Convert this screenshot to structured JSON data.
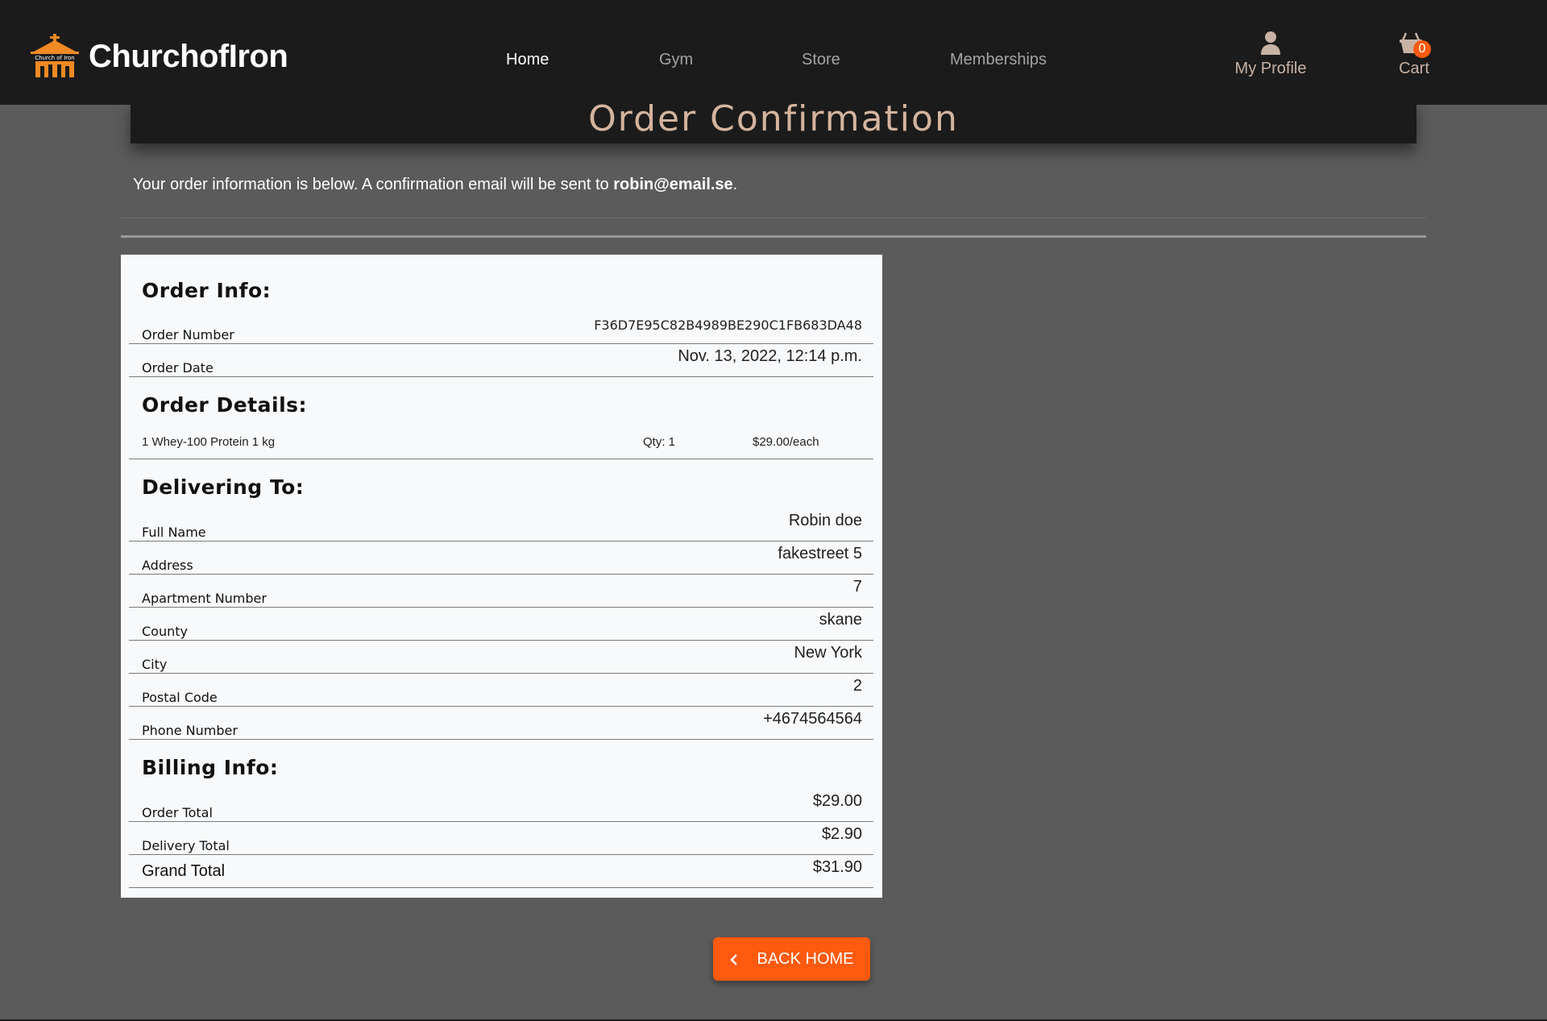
{
  "nav": {
    "brand": "ChurchofIron",
    "brand_mark_text": "Church of Iron",
    "links": [
      {
        "label": "Home",
        "active": true
      },
      {
        "label": "Gym",
        "active": false
      },
      {
        "label": "Store",
        "active": false
      },
      {
        "label": "Memberships",
        "active": false
      }
    ],
    "profile_label": "My Profile",
    "cart_label": "Cart",
    "cart_count": "0"
  },
  "page": {
    "title": "Order Confirmation",
    "intro_prefix": "Your order information is below. A confirmation email will be sent to ",
    "intro_email": "robin@email.se",
    "intro_suffix": "."
  },
  "order_info": {
    "heading": "Order Info:",
    "order_number_label": "Order Number",
    "order_number": "F36D7E95C82B4989BE290C1FB683DA48",
    "order_date_label": "Order Date",
    "order_date": "Nov. 13, 2022, 12:14 p.m."
  },
  "order_details": {
    "heading": "Order Details:",
    "items": [
      {
        "name": "1 Whey-100 Protein 1 kg",
        "qty": "Qty: 1",
        "price": "$29.00/each"
      }
    ]
  },
  "delivery": {
    "heading": "Delivering To:",
    "fields": [
      {
        "label": "Full Name",
        "value": "Robin doe"
      },
      {
        "label": "Address",
        "value": "fakestreet 5"
      },
      {
        "label": "Apartment Number",
        "value": "7"
      },
      {
        "label": "County",
        "value": "skane"
      },
      {
        "label": "City",
        "value": "New York"
      },
      {
        "label": "Postal Code",
        "value": "2"
      },
      {
        "label": "Phone Number",
        "value": "+4674564564"
      }
    ]
  },
  "billing": {
    "heading": "Billing Info:",
    "order_total_label": "Order Total",
    "order_total": "$29.00",
    "delivery_total_label": "Delivery Total",
    "delivery_total": "$2.90",
    "grand_total_label": "Grand Total",
    "grand_total": "$31.90"
  },
  "actions": {
    "back_home": "BACK HOME"
  },
  "colors": {
    "accent": "#ff5a0f",
    "navbar": "#1b1b1b",
    "background": "#5b5b5b",
    "title": "#d4b49e"
  }
}
